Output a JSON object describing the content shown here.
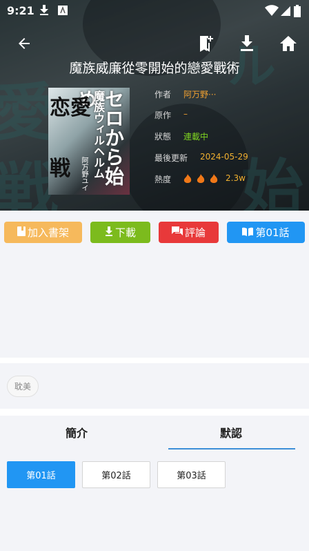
{
  "status_bar": {
    "time": "9:21"
  },
  "header": {
    "title": "魔族威廉從零開始的戀愛戰術",
    "back_icon": "arrow-left-icon",
    "bookmark_icon": "bookmark-add-icon",
    "download_icon": "download-icon",
    "home_icon": "home-icon"
  },
  "cover": {
    "line1": "セロから始め",
    "line2": "魔族ウィルヘルム",
    "line3": "恋愛",
    "line4": "戦",
    "author": "阿万野ユイ"
  },
  "meta": {
    "author_label": "作者",
    "author_value": "阿万野···",
    "original_label": "原作",
    "original_value": "–",
    "status_label": "狀態",
    "status_value": "連載中",
    "updated_label": "最後更新",
    "updated_value": "2024-05-29",
    "heat_label": "熱度",
    "heat_value": "2.3w"
  },
  "actions": {
    "shelf": "加入書架",
    "download": "下載",
    "comment": "評論",
    "read": "第01話"
  },
  "colors": {
    "shelf": "#f6b95c",
    "download": "#7cbb1d",
    "comment": "#e8393a",
    "read": "#2196f3",
    "accent": "#2196f3"
  },
  "tags": [
    "耽美"
  ],
  "tabs": {
    "intro": "簡介",
    "default": "默認"
  },
  "chapters": [
    "第01話",
    "第02話",
    "第03話"
  ]
}
